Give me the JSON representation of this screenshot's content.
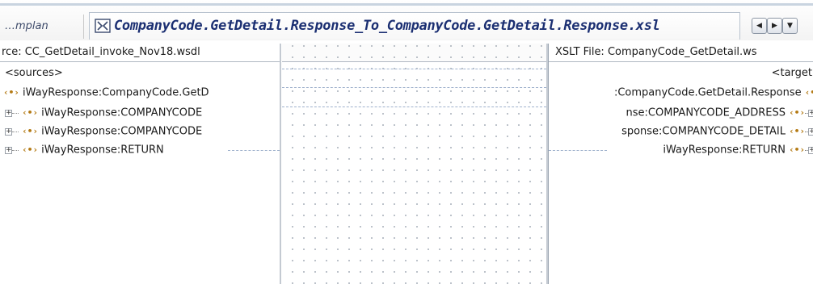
{
  "tabs": {
    "prev_label": "…mplan",
    "active_label": "CompanyCode.GetDetail.Response_To_CompanyCode.GetDetail.Response.xsl"
  },
  "icons": {
    "map_tab": "mapper-icon",
    "element": "element-icon",
    "expand": "expand-icon",
    "nav_left": "scroll-left-icon",
    "nav_right": "scroll-right-icon",
    "nav_menu": "tab-list-icon"
  },
  "source": {
    "header": "rce: CC_GetDetail_invoke_Nov18.wsdl",
    "root": "<sources>",
    "nodes": [
      {
        "label": "iWayResponse:CompanyCode.GetD",
        "level": 0,
        "expandable": false
      },
      {
        "label": "iWayResponse:COMPANYCODE",
        "level": 1,
        "expandable": true
      },
      {
        "label": "iWayResponse:COMPANYCODE",
        "level": 1,
        "expandable": true
      },
      {
        "label": "iWayResponse:RETURN",
        "level": 1,
        "expandable": true
      }
    ]
  },
  "target": {
    "header": "XSLT File: CompanyCode_GetDetail.ws",
    "root": "<target",
    "nodes": [
      {
        "label": ":CompanyCode.GetDetail.Response",
        "expandable": false
      },
      {
        "label": "nse:COMPANYCODE_ADDRESS",
        "expandable": true
      },
      {
        "label": "sponse:COMPANYCODE_DETAIL",
        "expandable": true
      },
      {
        "label": "iWayResponse:RETURN",
        "expandable": true
      }
    ]
  },
  "colors": {
    "tab_title": "#1b2f72",
    "element_icon": "#b47a14",
    "mapping_line": "#9fb1cc"
  }
}
